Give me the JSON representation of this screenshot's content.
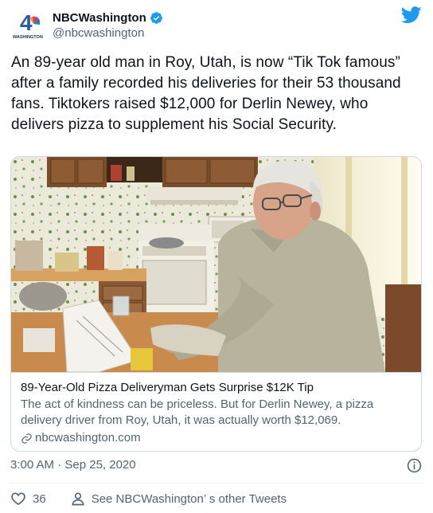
{
  "author": {
    "display_name": "NBCWashington",
    "handle": "@nbcwashington",
    "avatar_text": "WASHINGTON",
    "avatar_number": "4",
    "verified": true,
    "avatar_icon": "nbc-peacock-icon"
  },
  "tweet": {
    "text": "An 89-year old man in Roy, Utah, is now  “Tik Tok famous”  after a family recorded his deliveries for their 53 thousand fans. Tiktokers raised $12,000 for Derlin Newey, who delivers pizza to supplement his Social Security.",
    "timestamp": "3:00 AM · Sep 25, 2020"
  },
  "card": {
    "title": "89-Year-Old Pizza Deliveryman Gets Surprise $12K Tip",
    "description": "The act of kindness can be priceless. But for Derlin Newey, a pizza delivery driver from Roy, Utah, it was actually worth $12,069.",
    "domain": "nbcwashington.com",
    "image_icon": "kitchen-photo"
  },
  "footer": {
    "likes": "36",
    "see_other": "See NBCWashington’ s other Tweets"
  },
  "colors": {
    "twitter_blue": "#1d9bf0",
    "text_primary": "#0f1419",
    "text_secondary": "#536471",
    "border": "#cfd9de"
  }
}
